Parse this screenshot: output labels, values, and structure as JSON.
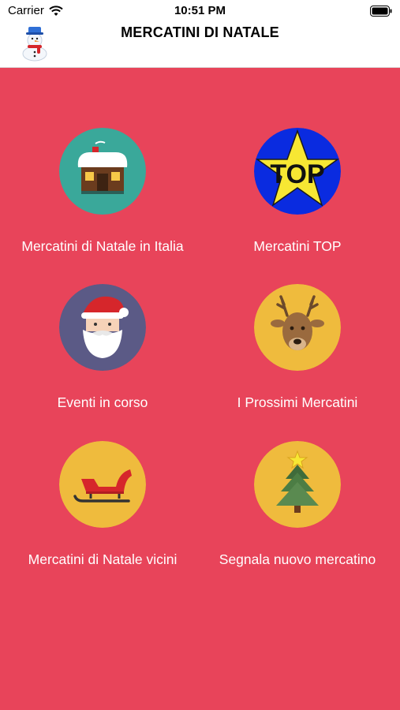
{
  "status_bar": {
    "carrier": "Carrier",
    "time": "10:51 PM",
    "wifi_icon": "wifi-icon",
    "battery_icon": "battery-icon"
  },
  "nav": {
    "title": "MERCATINI DI NATALE",
    "logo_icon": "snowman-icon"
  },
  "colors": {
    "background": "#e8445a",
    "label_text": "#ffffff",
    "teal_circle": "#3aa89a",
    "blue_circle": "#0a2be0",
    "purple_circle": "#5b5a86",
    "yellow_circle": "#efbb3d"
  },
  "menu": [
    {
      "label": "Mercatini di Natale in Italia",
      "icon": "house-icon"
    },
    {
      "label": "Mercatini TOP",
      "icon": "top-star-icon",
      "icon_text": "TOP"
    },
    {
      "label": "Eventi in corso",
      "icon": "santa-icon"
    },
    {
      "label": "I Prossimi Mercatini",
      "icon": "reindeer-icon"
    },
    {
      "label": "Mercatini di Natale vicini",
      "icon": "sleigh-icon"
    },
    {
      "label": "Segnala nuovo mercatino",
      "icon": "christmas-tree-icon"
    }
  ]
}
